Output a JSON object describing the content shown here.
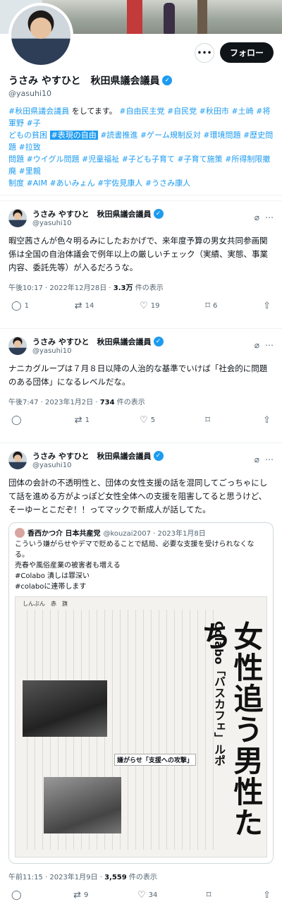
{
  "profile": {
    "name": "うさみ やすひと　秋田県議会議員",
    "handle": "@yasuhi10",
    "follow_label": "フォロー",
    "more_label": "•••",
    "bio_line1_pre": "#秋田県議会議員",
    "bio_line1_mid": " をしてます。",
    "bio_line1_tags": " #自由民主党 #自民党 #秋田市 #土崎 #将軍野 #子",
    "bio_line2_a": "どもの貧困 ",
    "bio_line2_hl": "#表現の自由",
    "bio_line2_b": " #読書推進 #ゲーム規制反対 #環境問題 #歴史問題 #拉致",
    "bio_line3": "問題 #ウイグル問題 #児童福祉 #子ども子育て #子育て施策 #所得制限撤廃 #里親",
    "bio_line4": "制度 #AIM #あいみょん #宇佐見康人 #うさみ康人"
  },
  "tweets": [
    {
      "name": "うさみ やすひと　秋田県議会議員",
      "handle": "@yasuhi10",
      "text": "暇空茜さんが色々明るみにしたおかげで、来年度予算の男女共同参画関係は全国の自治体議会で例年以上の厳しいチェック（実績、実態、事業内容、委託先等）が入るだろうな。",
      "time": "午後10:17 · 2022年12月28日 · ",
      "views": "3.3万",
      "views_label": " 件の表示",
      "replies": "1",
      "retweets": "14",
      "likes": "19",
      "bookmarks": "6"
    },
    {
      "name": "うさみ やすひと　秋田県議会議員",
      "handle": "@yasuhi10",
      "text": "ナニカグループは７月８日以降の人治的な基準でいけば「社会的に問題のある団体」になるレベルだな。",
      "time": "午後7:47 · 2023年1月2日 · ",
      "views": "734",
      "views_label": " 件の表示",
      "replies": "",
      "retweets": "1",
      "likes": "5",
      "bookmarks": ""
    },
    {
      "name": "うさみ やすひと　秋田県議会議員",
      "handle": "@yasuhi10",
      "text": "団体の会計の不透明性と、団体の女性支援の話を混同してごっちゃにして話を進める方がよっぽど女性全体への支援を阻害してると思うけど、そーゆーとこだぞ！！ってマックで新成人が話してた。",
      "time": "午前11:15 · 2023年1月9日 · ",
      "views": "3,559",
      "views_label": " 件の表示",
      "replies": "",
      "retweets": "9",
      "likes": "34",
      "bookmarks": "",
      "quote": {
        "name": "香西かつ介 日本共産党",
        "handle": "@kouzai2007 · 2023年1月8日",
        "line1": "こういう嫌がらせやデマで貶めることで結局、必要な支援を受けられなくなる。",
        "line2": "売春や風俗産業の被害者も増える",
        "line3": "#Colabo 潰しは罪深い",
        "line4": "#colaboに連帯します"
      },
      "newspaper": {
        "masthead": "しんぶん　赤　旗",
        "headline": "女性追う男性たち",
        "subtitle": "Colabo「バスカフェ」ルポ",
        "subhead": "嫌がらせ「支援への攻撃」"
      }
    }
  ]
}
